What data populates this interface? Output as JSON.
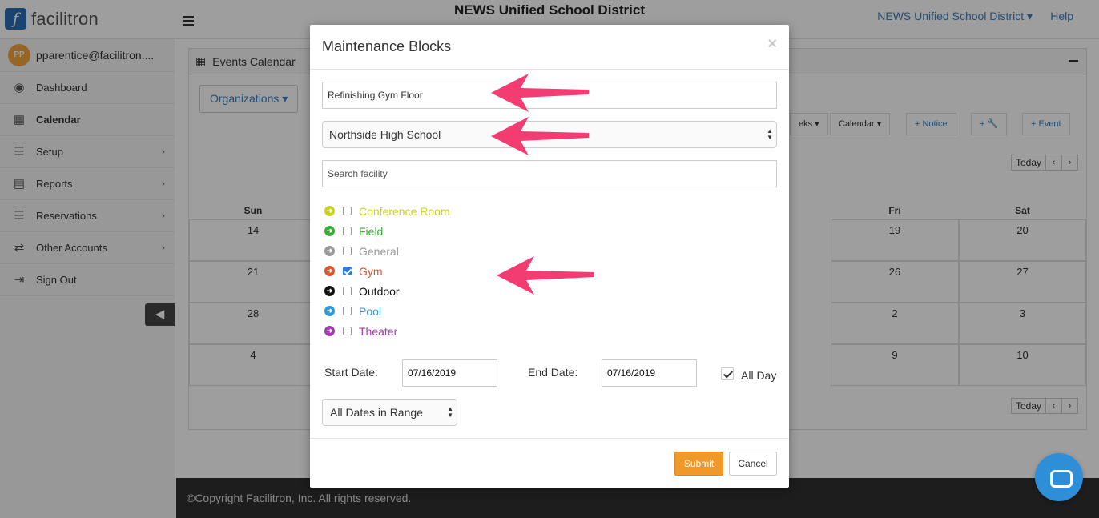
{
  "app": {
    "logo_text": "facilitron",
    "district_title": "NEWS Unified School District",
    "nav_district": "NEWS Unified School District ▾",
    "nav_help": "Help"
  },
  "user": {
    "initials": "PP",
    "name": "pparentice@facilitron...."
  },
  "sidebar": {
    "items": [
      {
        "label": "Dashboard",
        "icon": "dashboard-icon"
      },
      {
        "label": "Calendar",
        "icon": "calendar-icon"
      },
      {
        "label": "Setup",
        "icon": "list-icon"
      },
      {
        "label": "Reports",
        "icon": "document-icon"
      },
      {
        "label": "Reservations",
        "icon": "list-icon"
      },
      {
        "label": "Other Accounts",
        "icon": "exchange-icon"
      },
      {
        "label": "Sign Out",
        "icon": "sign-out-icon"
      }
    ]
  },
  "calendar": {
    "panel_title": "Events Calendar",
    "organizations_label": "Organizations ▾",
    "toolbar": [
      "eks ▾",
      "Calendar ▾",
      "+ Notice",
      "+ 🔧",
      "+ Event"
    ],
    "today_label": "Today",
    "day_headers": [
      "Sun",
      "Fri",
      "Sat"
    ],
    "rows": [
      [
        "14",
        "19",
        "20"
      ],
      [
        "21",
        "26",
        "27"
      ],
      [
        "28",
        "2",
        "3"
      ],
      [
        "4",
        "9",
        "10"
      ]
    ]
  },
  "footer": {
    "text": "©Copyright Facilitron, Inc. All rights reserved."
  },
  "modal": {
    "title": "Maintenance Blocks",
    "close_label": "×",
    "block_name_value": "Refinishing Gym Floor",
    "school_selected": "Northside High School",
    "search_placeholder": "Search facility",
    "facilities": [
      {
        "label": "Conference Room",
        "color": "#c9d21c",
        "checked": false
      },
      {
        "label": "Field",
        "color": "#35b035",
        "checked": false
      },
      {
        "label": "General",
        "color": "#9a9a9a",
        "checked": false
      },
      {
        "label": "Gym",
        "color": "#e0532b",
        "checked": true
      },
      {
        "label": "Outdoor",
        "color": "#111111",
        "checked": false
      },
      {
        "label": "Pool",
        "color": "#2a9ae0",
        "checked": false
      },
      {
        "label": "Theater",
        "color": "#a63ab5",
        "checked": false
      }
    ],
    "start_date_label": "Start Date:",
    "start_date_value": "07/16/2019",
    "end_date_label": "End Date:",
    "end_date_value": "07/16/2019",
    "all_day_label": "All Day",
    "all_day_checked": true,
    "range_selected": "All Dates in Range",
    "submit_label": "Submit",
    "cancel_label": "Cancel"
  },
  "annotation_color": "#f23c72"
}
